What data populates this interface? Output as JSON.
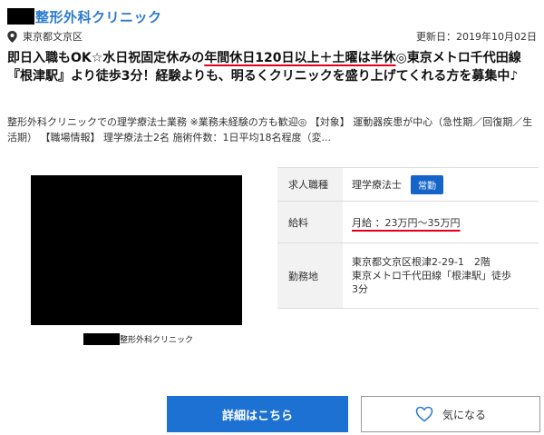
{
  "header": {
    "clinic_name": "整形外科クリニック"
  },
  "meta": {
    "location_icon": "map-pin-icon",
    "location": "東京都文京区",
    "updated": "更新日：2019年10月02日"
  },
  "headline": {
    "part1": "即日入職もOK☆水日祝固定休みの",
    "highlight": "年間休日120日以上＋土曜は半休",
    "part2": "◎東京メトロ千代田線『根津駅』より徒歩3分！経験よりも、明るくクリニックを盛り上げてくれる方を募集中♪"
  },
  "description": "整形外科クリニックでの理学療法士業務 ※業務未経験の方も歓迎◎ 【対象】 運動器疾患が中心（急性期／回復期／生活期） 【職場情報】 理学療法士2名 施術件数：1日平均18名程度（変...",
  "caption": {
    "text": "整形外科クリニック"
  },
  "info": {
    "job_label": "求人職種",
    "job_value": "理学療法士",
    "job_badge": "常勤",
    "salary_label": "給料",
    "salary_value": "月給 ：23万円～35万円",
    "place_label": "勤務地",
    "place_line1": "東京都文京区根津2-29-1　2階",
    "place_line2": "東京メトロ千代田線「根津駅」徒歩",
    "place_line3": "3分"
  },
  "buttons": {
    "detail": "詳細はこちら",
    "favorite": "気になる",
    "favorite_icon": "heart-icon"
  },
  "colors": {
    "accent": "#1d71d2",
    "title_blue": "#2a7ad1",
    "underline_red": "#e0001b"
  }
}
